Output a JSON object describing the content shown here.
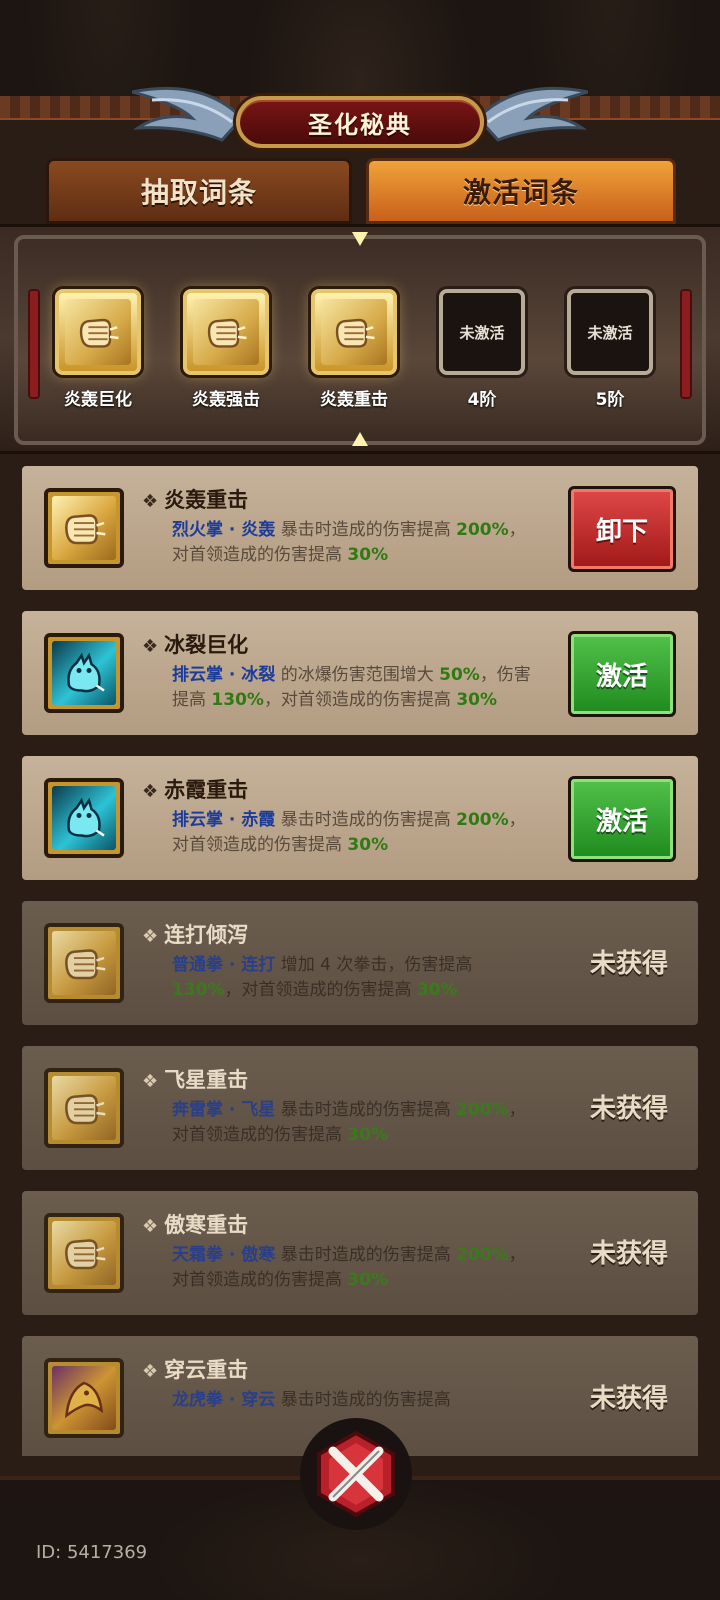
{
  "header": {
    "title": "圣化秘典"
  },
  "tabs": [
    {
      "label": "抽取词条",
      "active": false
    },
    {
      "label": "激活词条",
      "active": true
    }
  ],
  "slots": [
    {
      "label": "炎轰巨化",
      "filled": true,
      "icon": "fist-icon"
    },
    {
      "label": "炎轰强击",
      "filled": true,
      "icon": "fist-icon"
    },
    {
      "label": "炎轰重击",
      "filled": true,
      "icon": "fist-icon"
    },
    {
      "label": "4阶",
      "filled": false,
      "empty_text": "未激活"
    },
    {
      "label": "5阶",
      "filled": false,
      "empty_text": "未激活"
    }
  ],
  "entries": [
    {
      "title": "炎轰重击",
      "icon": "fist-icon",
      "owned": true,
      "desc": [
        {
          "t": "烈火掌 · 炎轰",
          "c": "skill"
        },
        {
          "t": " 暴击时造成的伤害提高 ",
          "c": ""
        },
        {
          "t": "200%",
          "c": "num"
        },
        {
          "t": "，对首领造成的伤害提高 ",
          "c": ""
        },
        {
          "t": "30%",
          "c": "num"
        }
      ],
      "action": "卸下",
      "action_style": "red"
    },
    {
      "title": "冰裂巨化",
      "icon": "ice-beast-icon",
      "owned": true,
      "desc": [
        {
          "t": "排云掌 · 冰裂",
          "c": "skill"
        },
        {
          "t": " 的冰爆伤害范围增大 ",
          "c": ""
        },
        {
          "t": "50%",
          "c": "num"
        },
        {
          "t": "，伤害提高 ",
          "c": ""
        },
        {
          "t": "130%",
          "c": "num"
        },
        {
          "t": "，对首领造成的伤害提高 ",
          "c": ""
        },
        {
          "t": "30%",
          "c": "num"
        }
      ],
      "action": "激活",
      "action_style": "green"
    },
    {
      "title": "赤霞重击",
      "icon": "ice-beast-icon",
      "owned": true,
      "desc": [
        {
          "t": "排云掌 · 赤霞",
          "c": "skill"
        },
        {
          "t": " 暴击时造成的伤害提高 ",
          "c": ""
        },
        {
          "t": "200%",
          "c": "num"
        },
        {
          "t": "，对首领造成的伤害提高 ",
          "c": ""
        },
        {
          "t": "30%",
          "c": "num"
        }
      ],
      "action": "激活",
      "action_style": "green"
    },
    {
      "title": "连打倾泻",
      "icon": "fist-icon",
      "owned": false,
      "desc": [
        {
          "t": "普通拳 · 连打",
          "c": "skill"
        },
        {
          "t": " 增加 4 次拳击，伤害提高 ",
          "c": ""
        },
        {
          "t": "130%",
          "c": "num"
        },
        {
          "t": "，对首领造成的伤害提高 ",
          "c": ""
        },
        {
          "t": "30%",
          "c": "num"
        }
      ],
      "action": "未获得"
    },
    {
      "title": "飞星重击",
      "icon": "fist-icon",
      "owned": false,
      "desc": [
        {
          "t": "奔雷掌 · 飞星",
          "c": "skill"
        },
        {
          "t": " 暴击时造成的伤害提高 ",
          "c": ""
        },
        {
          "t": "200%",
          "c": "num"
        },
        {
          "t": "，对首领造成的伤害提高 ",
          "c": ""
        },
        {
          "t": "30%",
          "c": "num"
        }
      ],
      "action": "未获得"
    },
    {
      "title": "傲寒重击",
      "icon": "fist-icon",
      "owned": false,
      "desc": [
        {
          "t": "天霜拳 · 傲寒",
          "c": "skill"
        },
        {
          "t": " 暴击时造成的伤害提高 ",
          "c": ""
        },
        {
          "t": "200%",
          "c": "num"
        },
        {
          "t": "，对首领造成的伤害提高 ",
          "c": ""
        },
        {
          "t": "30%",
          "c": "num"
        }
      ],
      "action": "未获得"
    },
    {
      "title": "穿云重击",
      "icon": "dragon-icon",
      "owned": false,
      "desc": [
        {
          "t": "龙虎拳 · 穿云",
          "c": "skill"
        },
        {
          "t": " 暴击时造成的伤害提高",
          "c": ""
        }
      ],
      "action": "未获得"
    }
  ],
  "footer": {
    "id_text": "ID: 5417369"
  },
  "colors": {
    "accent_orange": "#e88a2a",
    "btn_red": "#c02a2a",
    "btn_green": "#34a834",
    "num_green": "#2f7a12",
    "skill_blue": "#1d3c9a"
  }
}
